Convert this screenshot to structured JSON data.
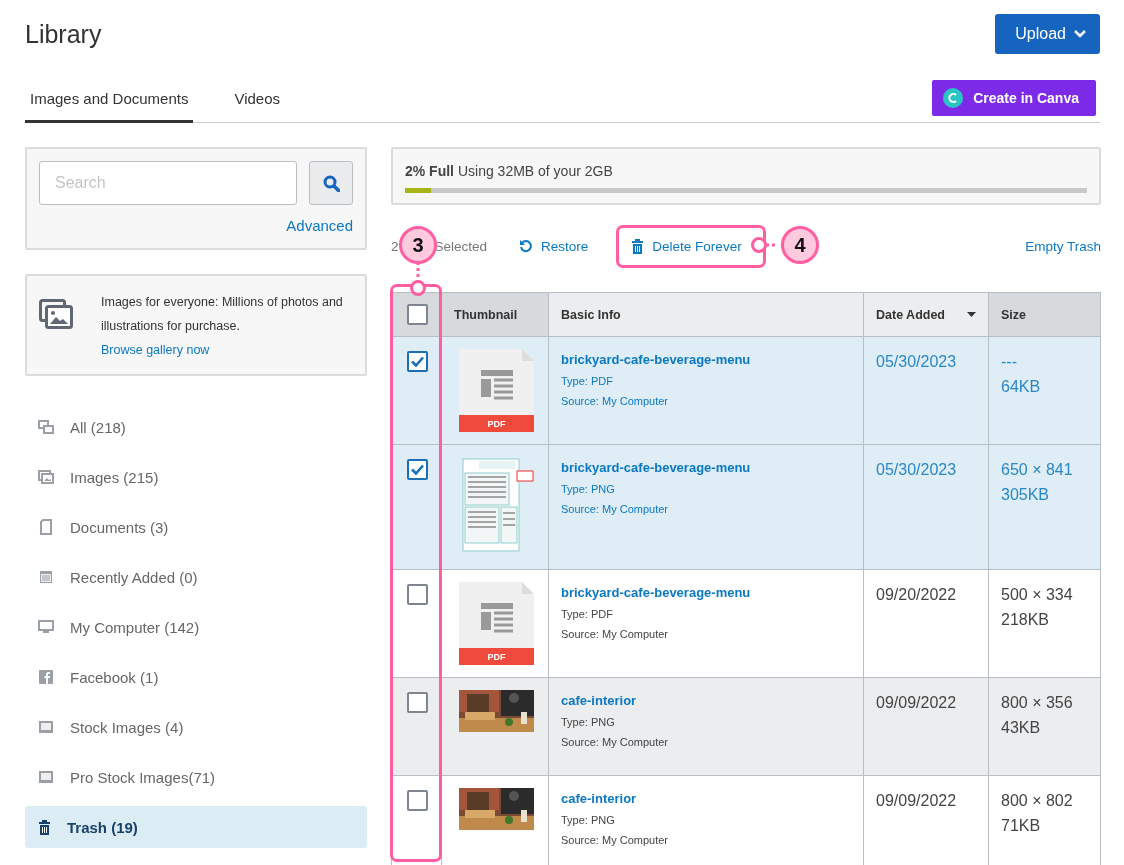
{
  "page": {
    "title": "Library"
  },
  "upload_button": {
    "label": "Upload"
  },
  "tabs": [
    {
      "label": "Images and Documents",
      "selected": true
    },
    {
      "label": "Videos",
      "selected": false
    }
  ],
  "canva_button": {
    "label": "Create in Canva"
  },
  "search": {
    "placeholder": "Search",
    "advanced_link": "Advanced"
  },
  "promo": {
    "text": "Images for everyone: Millions of photos and illustrations for purchase.",
    "link": "Browse gallery now"
  },
  "sidebar": {
    "items": [
      {
        "kind": "all",
        "label": "All (218)",
        "selected": false
      },
      {
        "kind": "images",
        "label": "Images (215)",
        "selected": false
      },
      {
        "kind": "documents",
        "label": "Documents (3)",
        "selected": false
      },
      {
        "kind": "recent",
        "label": "Recently Added (0)",
        "selected": false
      },
      {
        "kind": "computer",
        "label": "My Computer (142)",
        "selected": false
      },
      {
        "kind": "facebook",
        "label": "Facebook (1)",
        "selected": false
      },
      {
        "kind": "stock",
        "label": "Stock Images (4)",
        "selected": false
      },
      {
        "kind": "stock",
        "label": "Pro Stock Images(71)",
        "selected": false
      },
      {
        "kind": "trash",
        "label": "Trash (19)",
        "selected": true
      }
    ]
  },
  "storage": {
    "percent": "2% Full",
    "text": "Using 32MB of your 2GB",
    "level": 0.02
  },
  "actions": {
    "count": "2",
    "selected_label": "Selected",
    "restore": "Restore",
    "delete": "Delete Forever",
    "empty": "Empty Trash"
  },
  "table": {
    "columns": [
      {
        "kind": "check",
        "checked": false
      },
      {
        "kind": "thumb",
        "label": "Thumbnail"
      },
      {
        "kind": "info",
        "label": "Basic Info"
      },
      {
        "kind": "date",
        "label": "Date Added",
        "sorted": true
      },
      {
        "kind": "size",
        "label": "Size"
      }
    ],
    "rows": [
      {
        "checked": true,
        "selected": true,
        "highlighted": false,
        "kind": "pdf",
        "thumb_label": "PDF",
        "name": "brickyard-cafe-beverage-menu",
        "type": "Type: PDF",
        "source": "Source: My Computer",
        "date": "05/30/2023",
        "dimensions": "---",
        "size": "64KB"
      },
      {
        "checked": true,
        "selected": true,
        "highlighted": false,
        "kind": "menu",
        "name": "brickyard-cafe-beverage-menu",
        "type": "Type: PNG",
        "source": "Source: My Computer",
        "date": "05/30/2023",
        "dimensions": "650 × 841",
        "size": "305KB"
      },
      {
        "checked": false,
        "selected": false,
        "highlighted": false,
        "kind": "pdf",
        "thumb_label": "PDF",
        "name": "brickyard-cafe-beverage-menu",
        "type": "Type: PDF",
        "source": "Source: My Computer",
        "date": "09/20/2022",
        "dimensions": "500 × 334",
        "size": "218KB"
      },
      {
        "checked": false,
        "selected": false,
        "highlighted": true,
        "name": "cafe-interior",
        "type": "Type: PNG",
        "source": "Source: My Computer",
        "date": "09/09/2022",
        "dimensions": "800 × 356",
        "size": "43KB"
      },
      {
        "checked": false,
        "selected": false,
        "highlighted": false,
        "name": "cafe-interior",
        "type": "Type: PNG",
        "source": "Source: My Computer",
        "date": "09/09/2022",
        "dimensions": "800 × 802",
        "size": "71KB"
      }
    ]
  },
  "annotations": [
    {
      "label": "3",
      "kind": "checkbox-column"
    },
    {
      "label": "4",
      "kind": "delete-button"
    }
  ]
}
